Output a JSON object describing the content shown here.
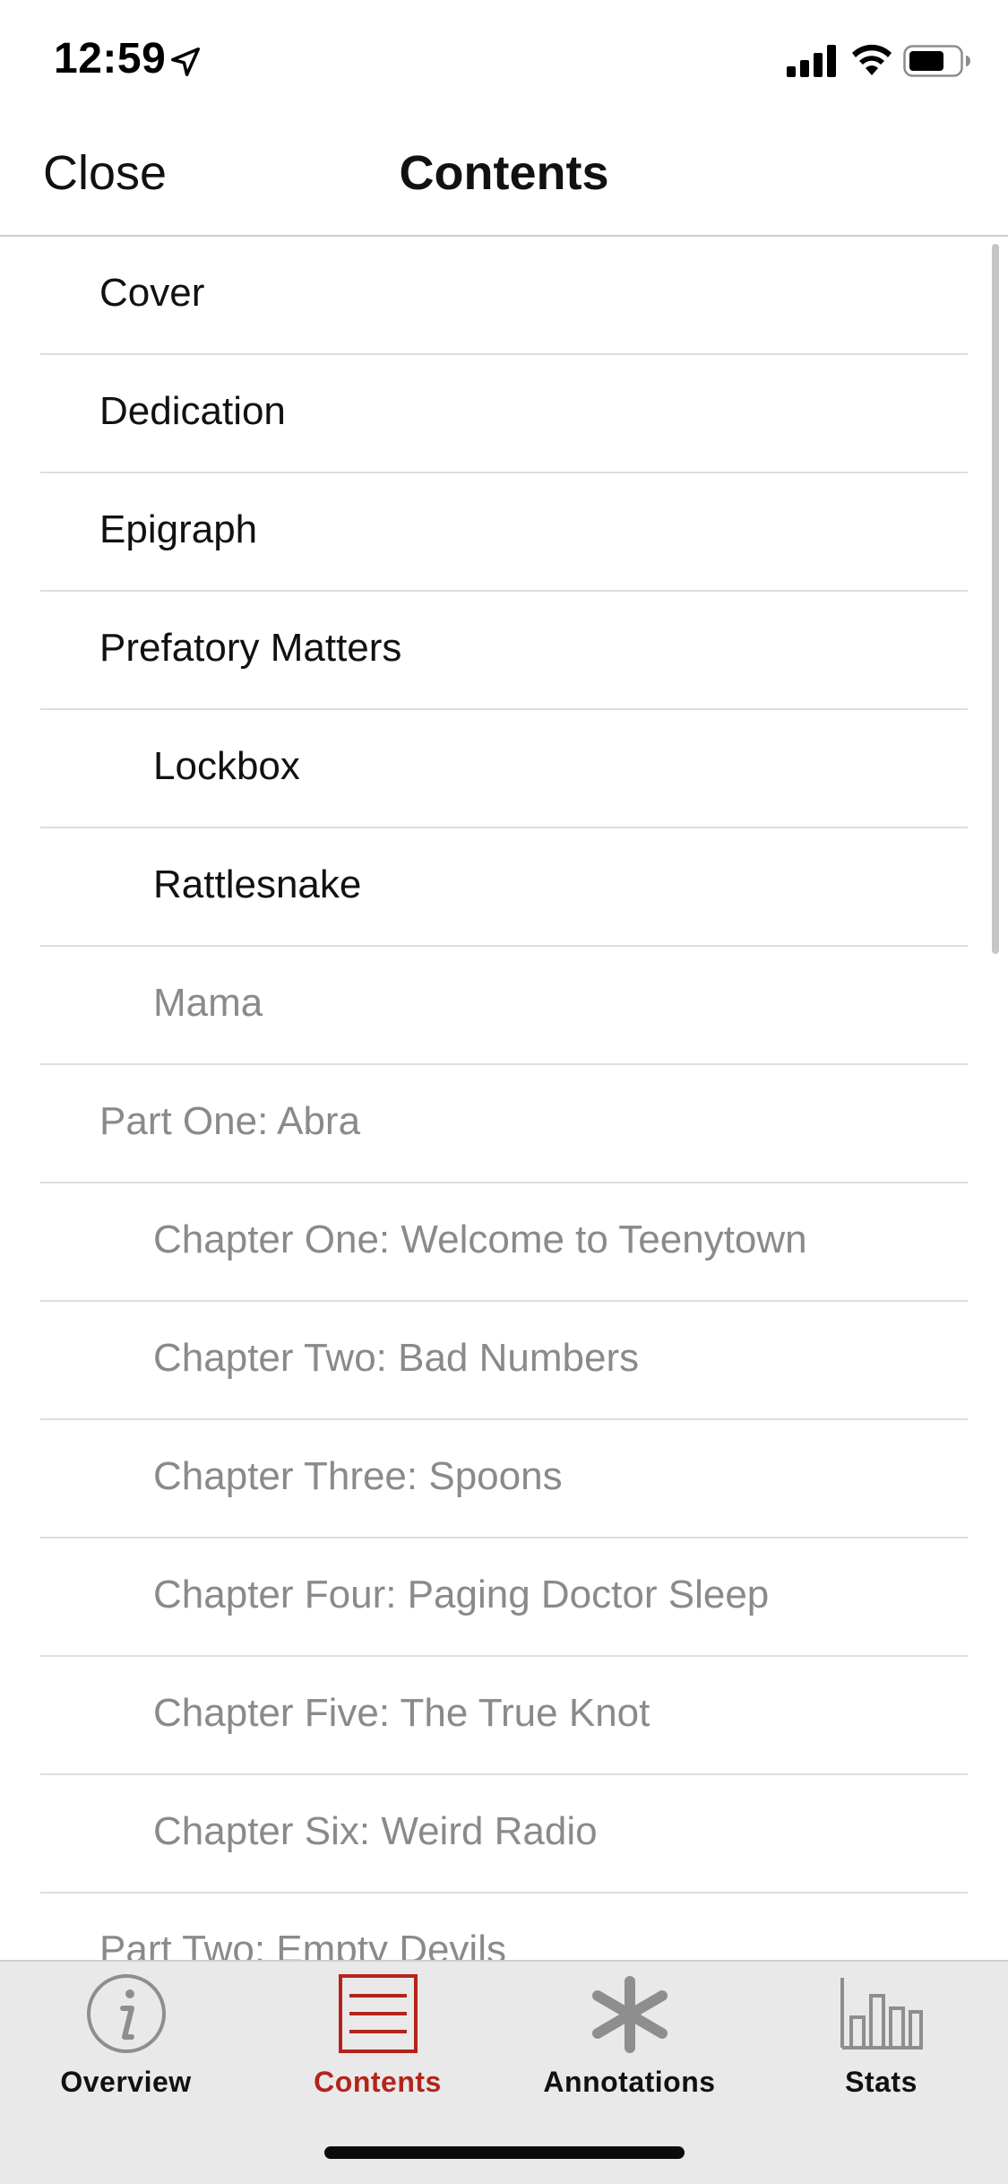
{
  "status_bar": {
    "time": "12:59",
    "icons": [
      "location-arrow-icon",
      "cellular-signal-icon",
      "wifi-icon",
      "battery-icon"
    ]
  },
  "nav": {
    "close_label": "Close",
    "title": "Contents"
  },
  "toc": {
    "items": [
      {
        "label": "Cover",
        "level": 0,
        "read": true
      },
      {
        "label": "Dedication",
        "level": 0,
        "read": true
      },
      {
        "label": "Epigraph",
        "level": 0,
        "read": true
      },
      {
        "label": "Prefatory Matters",
        "level": 0,
        "read": true
      },
      {
        "label": "Lockbox",
        "level": 1,
        "read": true
      },
      {
        "label": "Rattlesnake",
        "level": 1,
        "read": true
      },
      {
        "label": "Mama",
        "level": 1,
        "read": false
      },
      {
        "label": "Part One: Abra",
        "level": 0,
        "read": false
      },
      {
        "label": "Chapter One: Welcome to Teenytown",
        "level": 1,
        "read": false
      },
      {
        "label": "Chapter Two: Bad Numbers",
        "level": 1,
        "read": false
      },
      {
        "label": "Chapter Three: Spoons",
        "level": 1,
        "read": false
      },
      {
        "label": "Chapter Four: Paging Doctor Sleep",
        "level": 1,
        "read": false
      },
      {
        "label": "Chapter Five: The True Knot",
        "level": 1,
        "read": false
      },
      {
        "label": "Chapter Six: Weird Radio",
        "level": 1,
        "read": false
      },
      {
        "label": "Part Two: Empty Devils",
        "level": 0,
        "read": false
      }
    ]
  },
  "tabs": [
    {
      "label": "Overview",
      "icon": "info-icon",
      "active": false
    },
    {
      "label": "Contents",
      "icon": "contents-list-icon",
      "active": true
    },
    {
      "label": "Annotations",
      "icon": "asterisk-icon",
      "active": false
    },
    {
      "label": "Stats",
      "icon": "bar-chart-icon",
      "active": false
    }
  ],
  "colors": {
    "accent": "#b3241c",
    "read_text": "#111111",
    "unread_text": "#8a8a8a",
    "tab_bar_bg": "#e9e9e9",
    "icon_gray": "#8e8e8e"
  }
}
